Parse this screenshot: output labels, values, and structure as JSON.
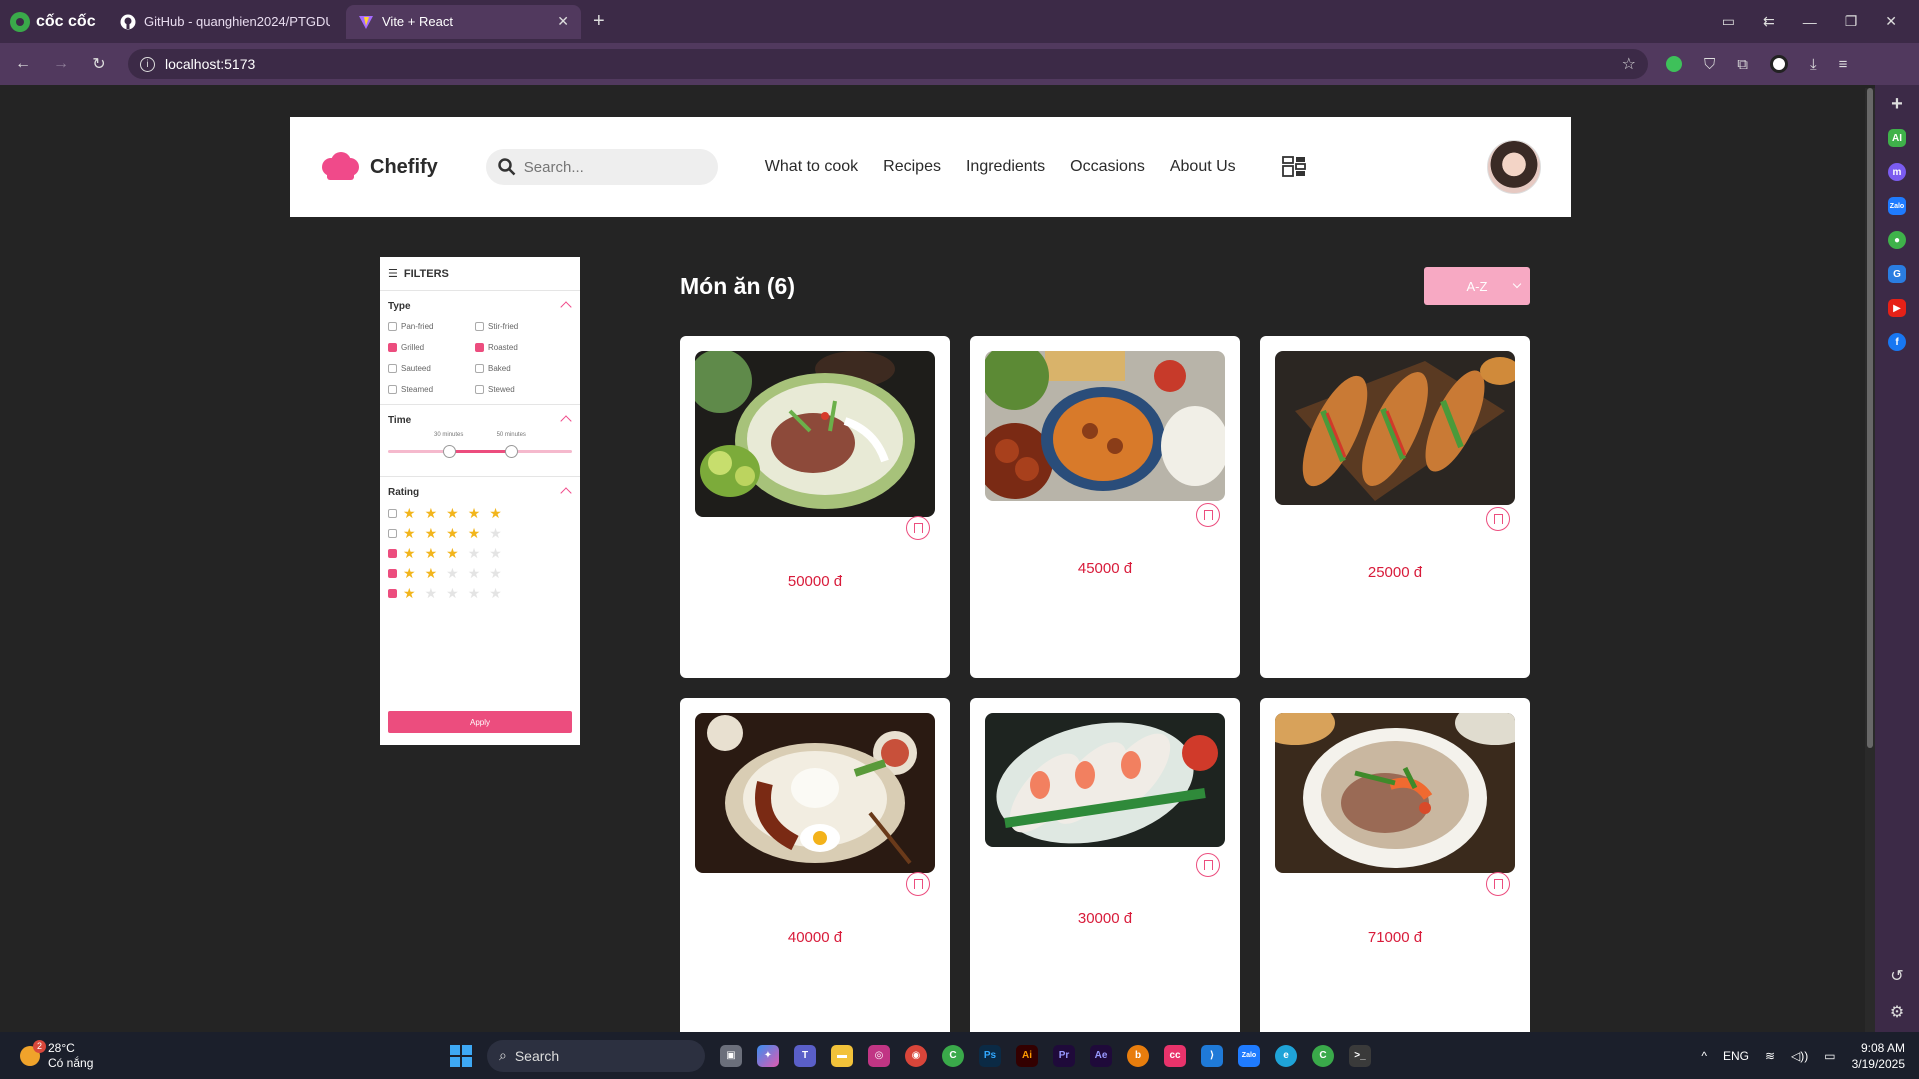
{
  "browser": {
    "brand": "cốc cốc",
    "tabs": [
      {
        "title": "GitHub - quanghien2024/PTGDUD",
        "active": false
      },
      {
        "title": "Vite + React",
        "active": true
      }
    ],
    "url": "localhost:5173"
  },
  "site": {
    "name": "Chefify",
    "search_placeholder": "Search...",
    "menu": [
      "What to cook",
      "Recipes",
      "Ingredients",
      "Occasions",
      "About Us"
    ]
  },
  "filters": {
    "title": "FILTERS",
    "type_title": "Type",
    "types": [
      {
        "label": "Pan-fried",
        "checked": false
      },
      {
        "label": "Stir-fried",
        "checked": false
      },
      {
        "label": "Grilled",
        "checked": true
      },
      {
        "label": "Roasted",
        "checked": true
      },
      {
        "label": "Sauteed",
        "checked": false
      },
      {
        "label": "Baked",
        "checked": false
      },
      {
        "label": "Steamed",
        "checked": false
      },
      {
        "label": "Stewed",
        "checked": false
      }
    ],
    "time_title": "Time",
    "time_min_label": "30 minutes",
    "time_max_label": "50 minutes",
    "time_min_fraction": 0.33,
    "time_max_fraction": 0.67,
    "rating_title": "Rating",
    "ratings": [
      {
        "stars": 5,
        "checked": false
      },
      {
        "stars": 4,
        "checked": false
      },
      {
        "stars": 3,
        "checked": true
      },
      {
        "stars": 2,
        "checked": true
      },
      {
        "stars": 1,
        "checked": true
      }
    ],
    "apply_label": "Apply"
  },
  "content": {
    "heading": "Món ăn (6)",
    "sort_value": "A-Z",
    "dishes": [
      {
        "price": "50000 đ",
        "image": "pho-bowl"
      },
      {
        "price": "45000 đ",
        "image": "bun-cha"
      },
      {
        "price": "25000 đ",
        "image": "banh-mi"
      },
      {
        "price": "40000 đ",
        "image": "com-tam"
      },
      {
        "price": "30000 đ",
        "image": "goi-cuon"
      },
      {
        "price": "71000 đ",
        "image": "hu-tieu"
      }
    ]
  },
  "taskbar": {
    "temperature": "28°C",
    "weather": "Có nắng",
    "weather_badge": "2",
    "search_label": "Search",
    "language": "ENG",
    "time": "9:08 AM",
    "date": "3/19/2025"
  },
  "colors": {
    "accent": "#ec4d7e",
    "price": "#d81b3a",
    "browser": "#3c2a47"
  }
}
